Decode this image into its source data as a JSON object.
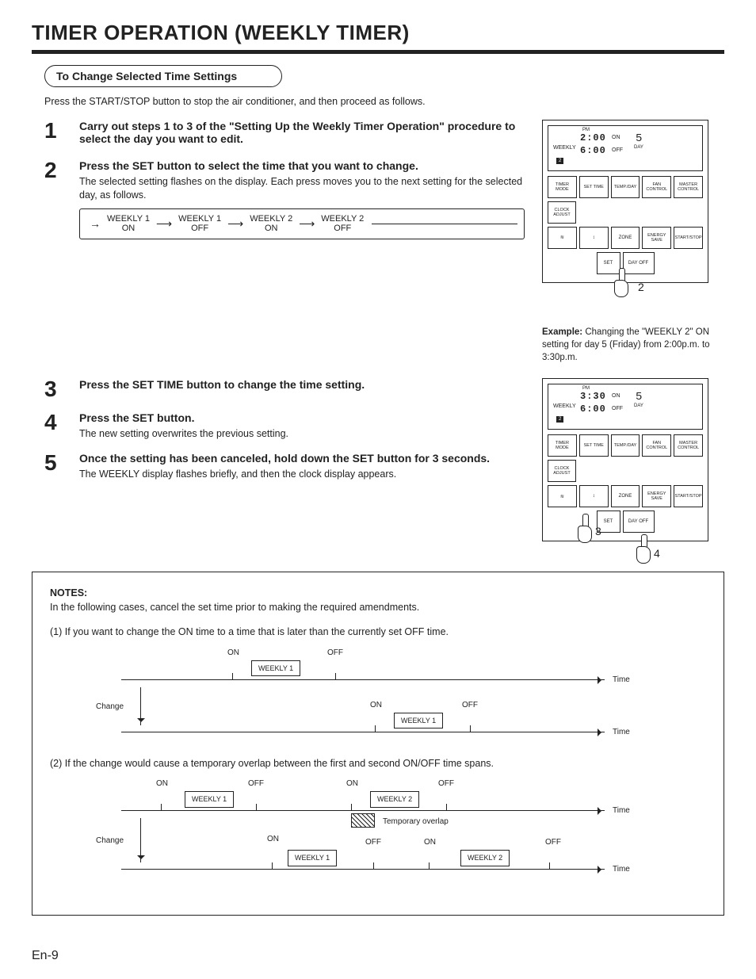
{
  "title": "TIMER OPERATION (WEEKLY TIMER)",
  "subhead": "To Change Selected Time Settings",
  "intro": "Press the START/STOP button to stop the air conditioner, and then proceed as follows.",
  "steps": {
    "1": {
      "num": "1",
      "title": "Carry out steps 1 to 3 of the \"Setting Up the Weekly Timer Operation\" procedure to select the day you want to edit."
    },
    "2": {
      "num": "2",
      "title": "Press the SET button to select the time that you want to change.",
      "desc": "The selected setting flashes on the display. Each press moves you to the next setting for the selected day, as follows."
    },
    "3": {
      "num": "3",
      "title": "Press the SET TIME button to change the time setting."
    },
    "4": {
      "num": "4",
      "title": "Press the SET button.",
      "desc": "The new setting overwrites the previous setting."
    },
    "5": {
      "num": "5",
      "title": "Once the setting has been canceled, hold down the SET button for 3 seconds.",
      "desc": "The WEEKLY display flashes briefly, and then the clock display appears."
    }
  },
  "seq": {
    "a": "WEEKLY 1",
    "a2": "ON",
    "b": "WEEKLY 1",
    "b2": "OFF",
    "c": "WEEKLY 2",
    "c2": "ON",
    "d": "WEEKLY 2",
    "d2": "OFF"
  },
  "remote": {
    "lcd1": {
      "pm": "PM",
      "t1": "2:00",
      "s1": "ON",
      "t2": "6:00",
      "s2": "OFF",
      "dayn": "5",
      "dayl": "DAY",
      "wk": "WEEKLY",
      "bar": "2"
    },
    "lcd2": {
      "pm": "PM",
      "t1": "3:30",
      "s1": "ON",
      "t2": "6:00",
      "s2": "OFF",
      "dayn": "5",
      "dayl": "DAY",
      "wk": "WEEKLY",
      "bar": "2"
    },
    "btn": {
      "timer": "TIMER MODE",
      "settime": "SET TIME",
      "temp": "TEMP./DAY",
      "fan": "FAN CONTROL",
      "master": "MASTER CONTROL",
      "clock": "CLOCK ADJUST",
      "swing": "≋",
      "set": "SET",
      "zone": "ZONE",
      "energy": "ENERGY SAVE",
      "start": "START/STOP",
      "dayoff": "DAY OFF",
      "vane": "⇵",
      "louver": "↕"
    },
    "h2": "2",
    "h3": "3",
    "h4": "4"
  },
  "example": {
    "label": "Example:",
    "text": "Changing the \"WEEKLY 2\" ON setting for day 5 (Friday) from 2:00p.m. to 3:30p.m."
  },
  "notes": {
    "title": "NOTES:",
    "lead": "In the following cases, cancel the set time prior to making the required amendments.",
    "n1": "(1) If you want to change the ON time to a time that is later than the currently set OFF time.",
    "n2": "(2) If the change would cause a temporary overlap between the first and second ON/OFF time spans.",
    "labels": {
      "on": "ON",
      "off": "OFF",
      "time": "Time",
      "change": "Change",
      "w1": "WEEKLY 1",
      "w2": "WEEKLY 2",
      "overlap": "Temporary overlap"
    }
  },
  "pagenum": "En-9"
}
